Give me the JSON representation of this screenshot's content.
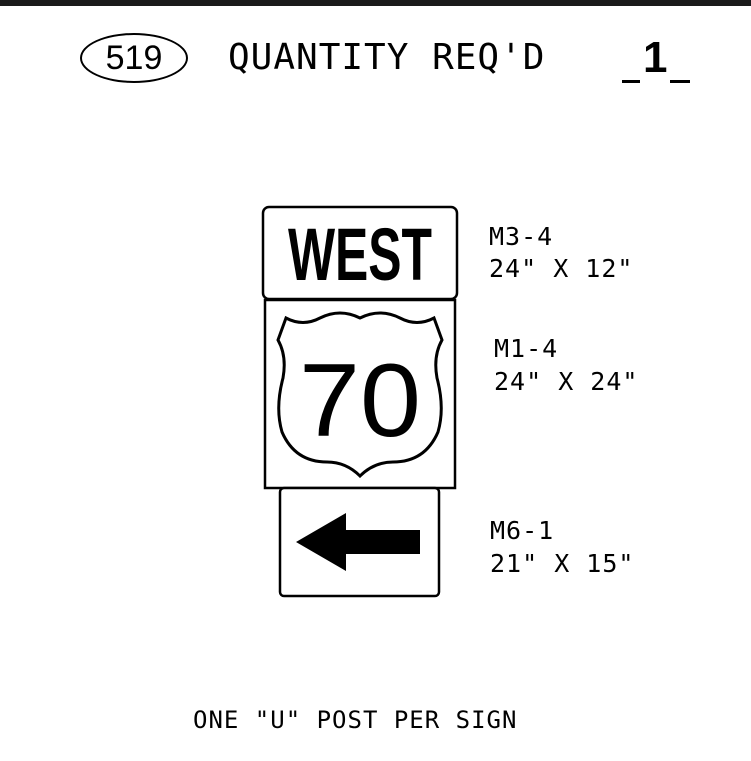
{
  "header": {
    "sheet_number": "519",
    "title": "QUANTITY REQ'D",
    "quantity": "1"
  },
  "signs": [
    {
      "legend": "WEST",
      "code": "M3-4",
      "size": "24\" X 12\""
    },
    {
      "legend": "70",
      "code": "M1-4",
      "size": "24\" X 24\""
    },
    {
      "legend_icon": "left-arrow-icon",
      "code": "M6-1",
      "size": "21\" X 15\""
    }
  ],
  "footer": {
    "note": "ONE \"U\" POST PER SIGN"
  }
}
